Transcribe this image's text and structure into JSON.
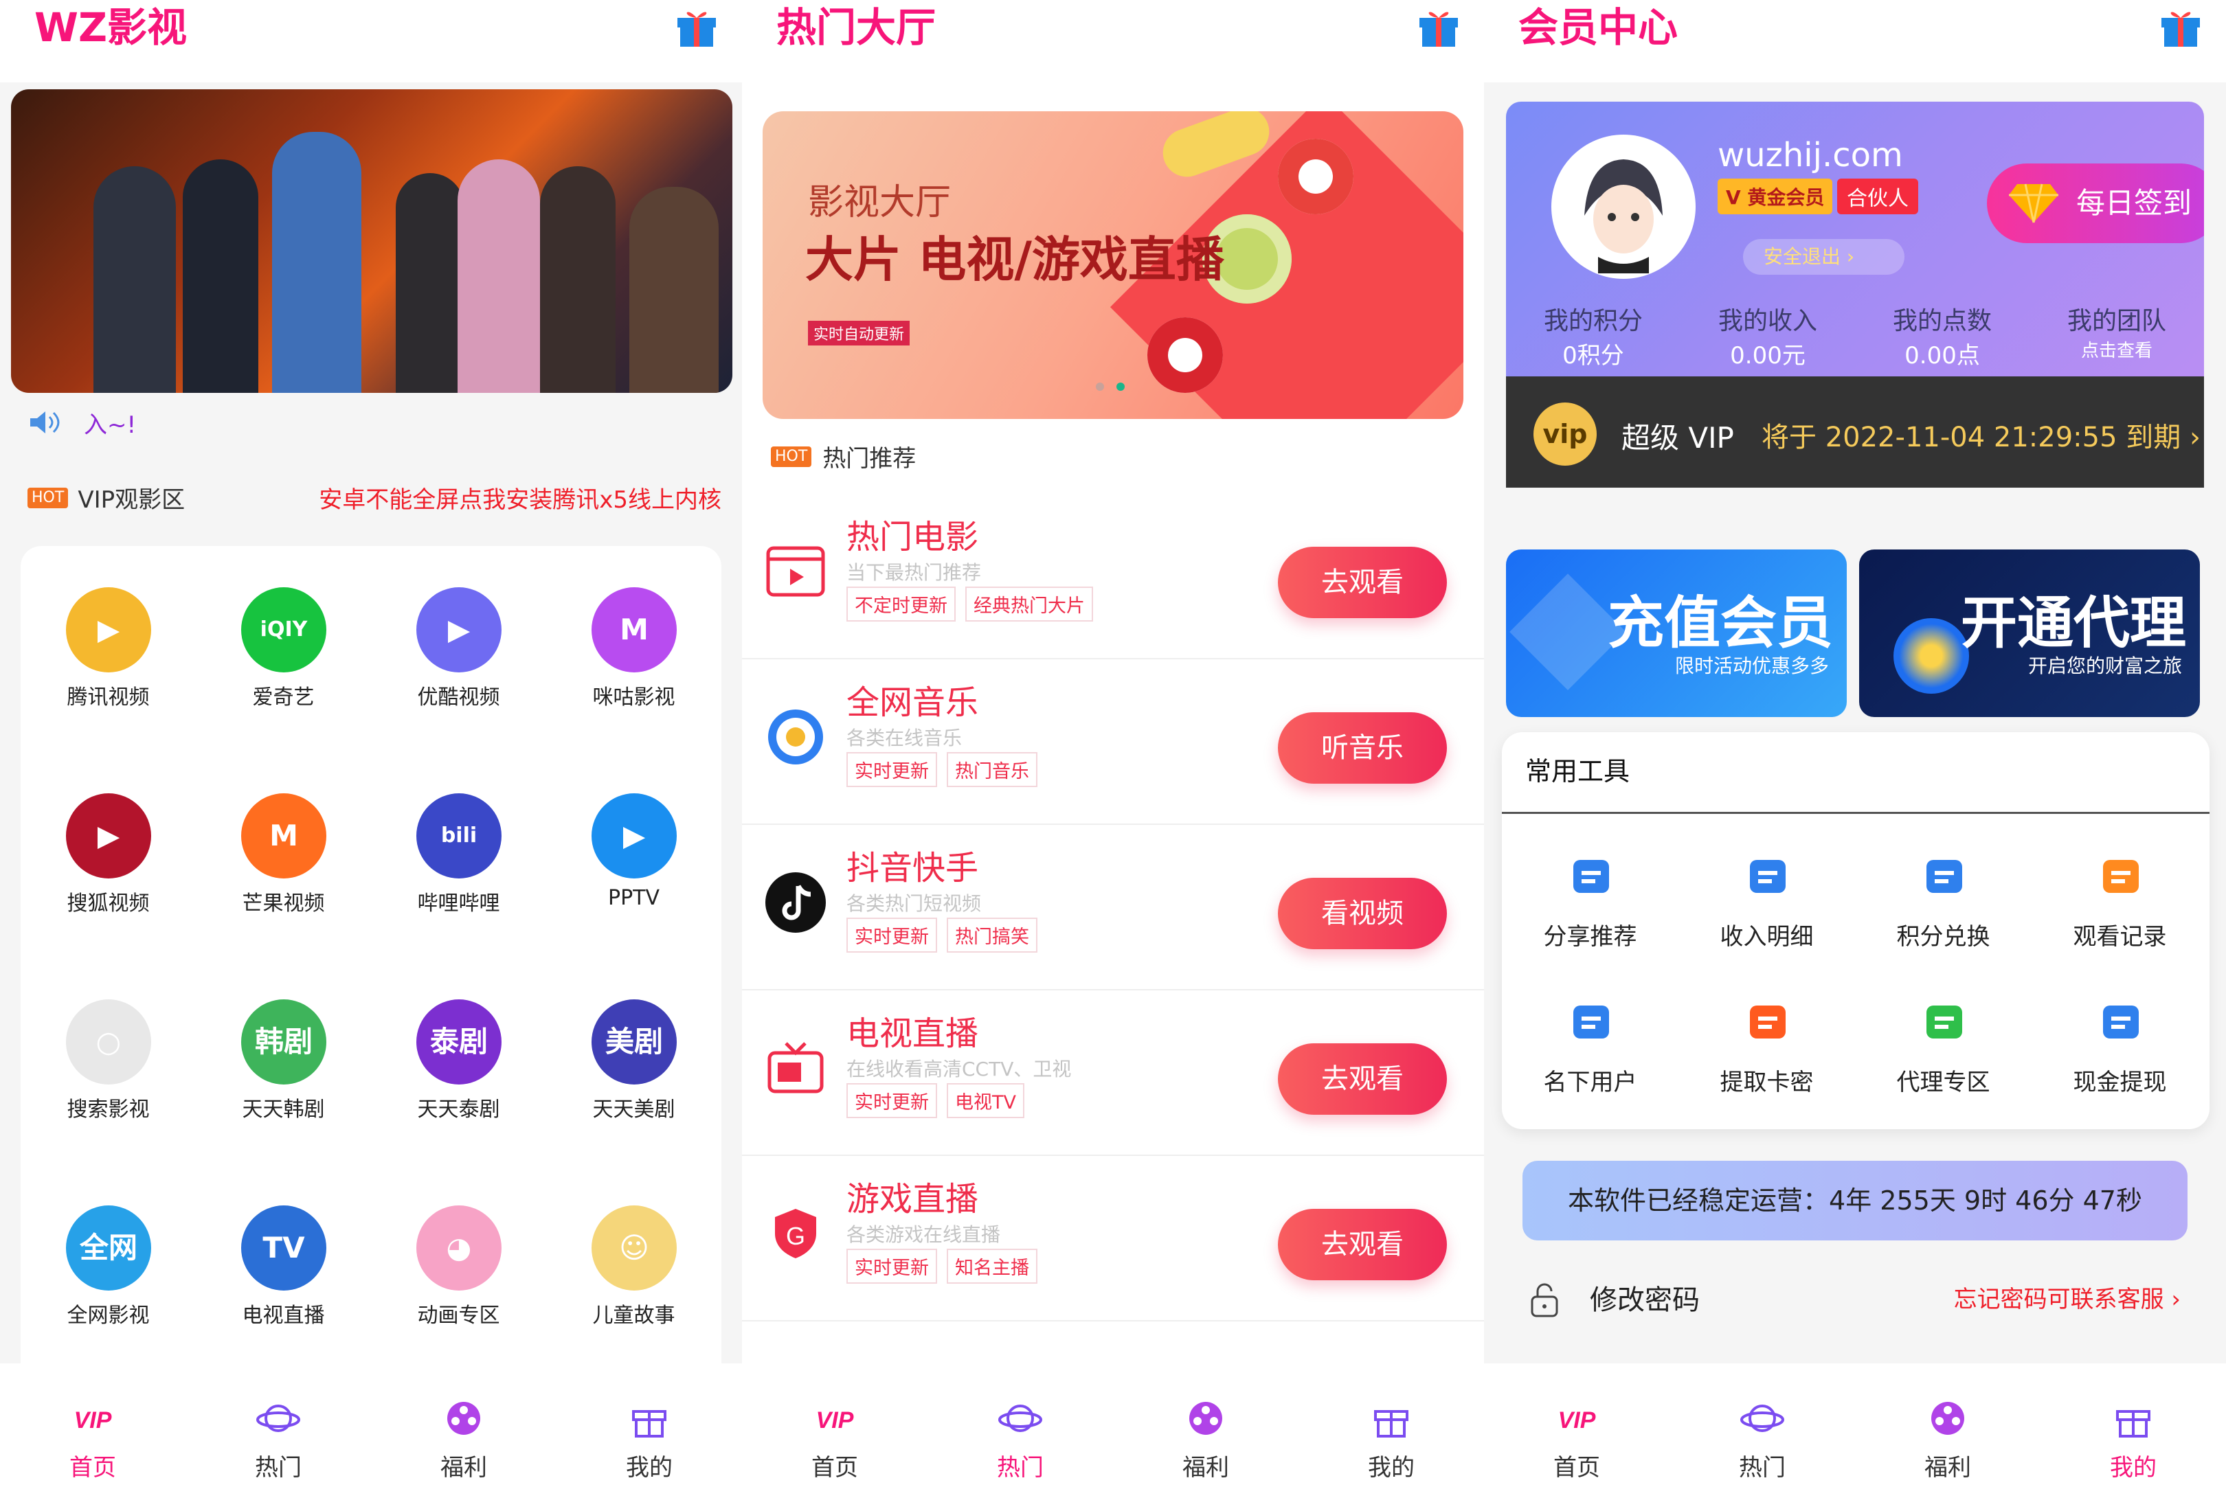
{
  "screen1": {
    "title": "WZ影视",
    "notice": "入~!",
    "hot_badge": "HOT",
    "section_title": "VIP观影区",
    "section_tip": "安卓不能全屏点我安装腾讯x5线上内核",
    "apps": [
      {
        "name": "腾讯视频",
        "glyph": "▶",
        "color": "#f5b82e"
      },
      {
        "name": "爱奇艺",
        "glyph": "iQIY",
        "color": "#17c33f"
      },
      {
        "name": "优酷视频",
        "glyph": "▶",
        "color": "#6f6bf2"
      },
      {
        "name": "咪咕影视",
        "glyph": "M",
        "color": "#b84cf0"
      },
      {
        "name": "搜狐视频",
        "glyph": "▶",
        "color": "#b3142c"
      },
      {
        "name": "芒果视频",
        "glyph": "M",
        "color": "#ff6d1f"
      },
      {
        "name": "哔哩哔哩",
        "glyph": "bili",
        "color": "#3a48c8"
      },
      {
        "name": "PPTV",
        "glyph": "▶",
        "color": "#1a8ff0"
      },
      {
        "name": "搜索影视",
        "glyph": "○",
        "color": "#e8e8e8"
      },
      {
        "name": "天天韩剧",
        "glyph": "韩剧",
        "color": "#3eb45b"
      },
      {
        "name": "天天泰剧",
        "glyph": "泰剧",
        "color": "#7c2fd0"
      },
      {
        "name": "天天美剧",
        "glyph": "美剧",
        "color": "#3f3fb5"
      },
      {
        "name": "全网影视",
        "glyph": "全网",
        "color": "#27a1e8"
      },
      {
        "name": "电视直播",
        "glyph": "TV",
        "color": "#2b6fd6"
      },
      {
        "name": "动画专区",
        "glyph": "◕",
        "color": "#f7a3c6"
      },
      {
        "name": "儿童故事",
        "glyph": "☺",
        "color": "#f5d67a"
      }
    ]
  },
  "screen2": {
    "title": "热门大厅",
    "banner_small": "影视大厅",
    "banner_big": "大片 电视/游戏直播",
    "banner_tag": "实时自动更新",
    "hot_badge": "HOT",
    "section_title": "热门推荐",
    "rows": [
      {
        "title": "热门电影",
        "desc": "当下最热门推荐",
        "tags": [
          "不定时更新",
          "经典热门大片"
        ],
        "button": "去观看",
        "icon": "film-icon",
        "color": "#ef2d4b"
      },
      {
        "title": "全网音乐",
        "desc": "各类在线音乐",
        "tags": [
          "实时更新",
          "热门音乐"
        ],
        "button": "听音乐",
        "icon": "music-icon",
        "color": "#2f7ff0"
      },
      {
        "title": "抖音快手",
        "desc": "各类热门短视频",
        "tags": [
          "实时更新",
          "热门搞笑"
        ],
        "button": "看视频",
        "icon": "tiktok-icon",
        "color": "#111111"
      },
      {
        "title": "电视直播",
        "desc": "在线收看高清CCTV、卫视",
        "tags": [
          "实时更新",
          "电视TV"
        ],
        "button": "去观看",
        "icon": "tv-icon",
        "color": "#ef2d4b"
      },
      {
        "title": "游戏直播",
        "desc": "各类游戏在线直播",
        "tags": [
          "实时更新",
          "知名主播"
        ],
        "button": "去观看",
        "icon": "game-icon",
        "color": "#ef2d4b"
      }
    ]
  },
  "screen3": {
    "title": "会员中心",
    "site": "wuzhij.com",
    "level": "黄金会员",
    "partner": "合伙人",
    "logout": "安全退出",
    "signin": "每日签到",
    "stats": [
      {
        "label": "我的积分",
        "value": "0积分"
      },
      {
        "label": "我的收入",
        "value": "0.00元"
      },
      {
        "label": "我的点数",
        "value": "0.00点"
      },
      {
        "label": "我的团队",
        "value": "点击查看"
      }
    ],
    "vip_badge": "vip",
    "vip_name": "超级 VIP",
    "vip_expire": "将于 2022-11-04 21:29:55 到期",
    "promo1_title": "充值会员",
    "promo1_sub": "限时活动优惠多多",
    "promo2_title": "开通代理",
    "promo2_sub": "开启您的财富之旅",
    "tools_title": "常用工具",
    "tools": [
      {
        "name": "分享推荐",
        "icon": "share-icon",
        "color": "#2f80ed"
      },
      {
        "name": "收入明细",
        "icon": "bill-icon",
        "color": "#2f80ed"
      },
      {
        "name": "积分兑换",
        "icon": "gift-icon",
        "color": "#2f80ed"
      },
      {
        "name": "观看记录",
        "icon": "video-icon",
        "color": "#ff8a1f"
      },
      {
        "name": "名下用户",
        "icon": "user-icon",
        "color": "#2f80ed"
      },
      {
        "name": "提取卡密",
        "icon": "flower-icon",
        "color": "#ff5a1f"
      },
      {
        "name": "代理专区",
        "icon": "home-icon",
        "color": "#2fbf4a"
      },
      {
        "name": "现金提现",
        "icon": "wallet-icon",
        "color": "#2f80ed"
      }
    ],
    "runtime": "本软件已经稳定运营：4年 255天 9时 46分 47秒",
    "pwd_label": "修改密码",
    "pwd_tip": "忘记密码可联系客服"
  },
  "tabbar": {
    "items": [
      "首页",
      "热门",
      "福利",
      "我的"
    ],
    "active_color": "#f7157a"
  }
}
